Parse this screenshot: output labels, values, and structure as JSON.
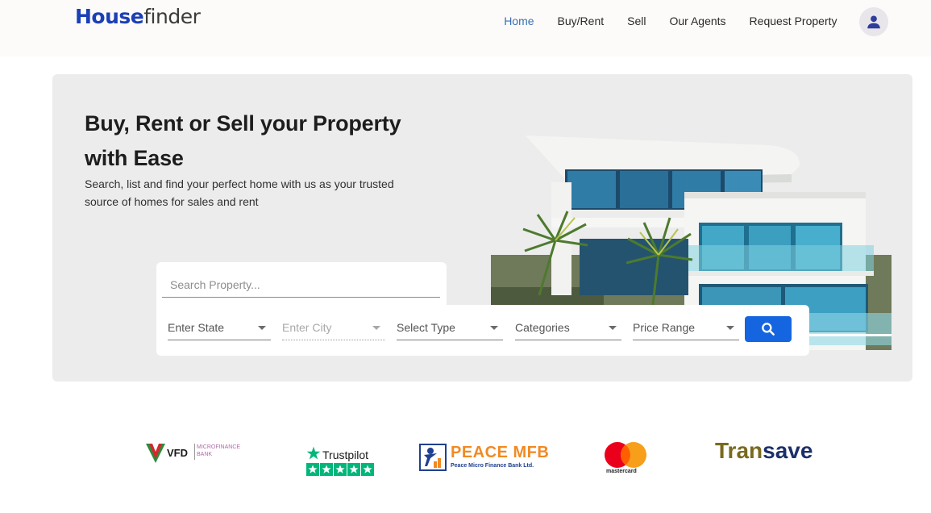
{
  "brand": {
    "part1": "House",
    "part2": "finder"
  },
  "nav": [
    {
      "label": "Home",
      "active": true
    },
    {
      "label": "Buy/Rent",
      "active": false
    },
    {
      "label": "Sell",
      "active": false
    },
    {
      "label": "Our Agents",
      "active": false
    },
    {
      "label": "Request Property",
      "active": false
    }
  ],
  "hero": {
    "title": "Buy, Rent or Sell your Property with Ease",
    "subtitle": "Search, list and find your perfect home with us as your trusted source of homes for sales and rent"
  },
  "search": {
    "placeholder": "Search Property...",
    "filters": [
      {
        "label": "Enter State"
      },
      {
        "label": "Enter City"
      },
      {
        "label": "Select Type"
      },
      {
        "label": "Categories"
      },
      {
        "label": "Price Range"
      }
    ]
  },
  "partners": {
    "vfd": {
      "name": "VFD",
      "sub1": "MICROFINANCE",
      "sub2": "BANK"
    },
    "trustpilot": {
      "name": "Trustpilot",
      "stars": 5
    },
    "peace": {
      "name": "PEACE MFB",
      "sub": "Peace Micro Finance Bank Ltd."
    },
    "mastercard": {
      "name": "mastercard"
    },
    "transave": {
      "part1": "Tran",
      "part2": "save"
    }
  },
  "colors": {
    "brand_blue": "#1b3fb5",
    "nav_active": "#3a6fb4",
    "button_blue": "#1565e0",
    "hero_bg": "#ececec"
  },
  "icons": {
    "avatar": "person-icon",
    "search_button": "search-icon",
    "dropdown": "caret-down-icon"
  }
}
